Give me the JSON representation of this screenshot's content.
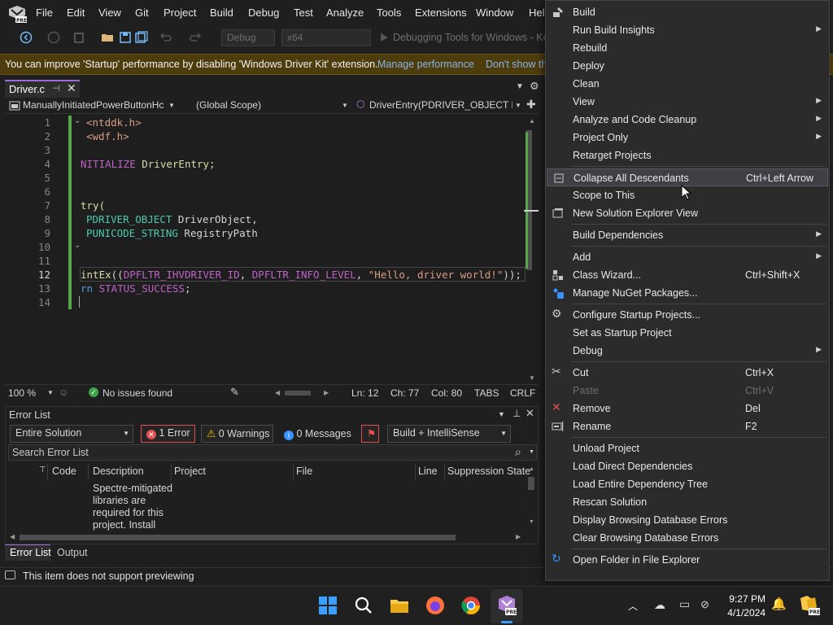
{
  "menubar": {
    "items": [
      "File",
      "Edit",
      "View",
      "Git",
      "Project",
      "Build",
      "Debug",
      "Test",
      "Analyze",
      "Tools",
      "Extensions",
      "Window",
      "Help"
    ]
  },
  "toolbar": {
    "config": "Debug",
    "platform": "x64",
    "debug_target": "Debugging Tools for Windows - Ker"
  },
  "infobar": {
    "message": "You can improve 'Startup' performance by disabling 'Windows Driver Kit' extension.",
    "link1": "Manage performance",
    "link2": "Don't show th"
  },
  "editor": {
    "tab_label": "Driver.c",
    "nav_project": "ManuallyInitiatedPowerButtonHc",
    "nav_scope": "(Global Scope)",
    "nav_function": "DriverEntry(PDRIVER_OBJECT Driv",
    "line_numbers": [
      "1",
      "2",
      "3",
      "4",
      "5",
      "6",
      "7",
      "8",
      "9",
      "10",
      "11",
      "12",
      "13",
      "14"
    ],
    "current_line": 12,
    "lines": {
      "l1": "<ntddk.h>",
      "l2": "<wdf.h>",
      "l4a": "NITIALIZE",
      "l4b": " DriverEntry;",
      "l7": "try(",
      "l8a": "PDRIVER_OBJECT",
      "l8b": " DriverObject,",
      "l9a": "PUNICODE_STRING",
      "l9b": " RegistryPath",
      "l12a": "intEx",
      "l12b": "((",
      "l12c": "DPFLTR_IHVDRIVER_ID",
      "l12d": ", ",
      "l12e": "DPFLTR_INFO_LEVEL",
      "l12f": ", ",
      "l12g": "\"Hello, driver world!\"",
      "l12h": "));",
      "l13a": "rn ",
      "l13b": "STATUS_SUCCESS",
      "l13c": ";"
    }
  },
  "editor_status": {
    "zoom": "100 %",
    "issues": "No issues found",
    "ln": "Ln: 12",
    "ch": "Ch: 77",
    "col": "Col: 80",
    "tabs": "TABS",
    "eol": "CRLF"
  },
  "error_list": {
    "title": "Error List",
    "scope": "Entire Solution",
    "errors": "1 Error",
    "warnings": "0 Warnings",
    "messages": "0 Messages",
    "build_filter": "Build + IntelliSense",
    "search_placeholder": "Search Error List",
    "columns": [
      "Code",
      "Description",
      "Project",
      "File",
      "Line",
      "Suppression State"
    ],
    "row_description": [
      "Spectre-mitigated",
      "libraries are",
      "required for this",
      "project. Install"
    ]
  },
  "bottom_tabs": [
    "Error List",
    "Output"
  ],
  "status": {
    "message": "This item does not support previewing"
  },
  "context_menu": {
    "items": [
      {
        "label": "Build",
        "shortcut": "",
        "submenu": false,
        "icon": "build-icon"
      },
      {
        "label": "Run Build Insights",
        "shortcut": "",
        "submenu": true,
        "icon": ""
      },
      {
        "label": "Rebuild",
        "shortcut": "",
        "submenu": false,
        "icon": ""
      },
      {
        "label": "Deploy",
        "shortcut": "",
        "submenu": false,
        "icon": ""
      },
      {
        "label": "Clean",
        "shortcut": "",
        "submenu": false,
        "icon": ""
      },
      {
        "label": "View",
        "shortcut": "",
        "submenu": true,
        "icon": ""
      },
      {
        "label": "Analyze and Code Cleanup",
        "shortcut": "",
        "submenu": true,
        "icon": ""
      },
      {
        "label": "Project Only",
        "shortcut": "",
        "submenu": true,
        "icon": ""
      },
      {
        "label": "Retarget Projects",
        "shortcut": "",
        "submenu": false,
        "icon": ""
      },
      {
        "label": "Collapse All Descendants",
        "shortcut": "Ctrl+Left Arrow",
        "submenu": false,
        "icon": "collapse-icon"
      },
      {
        "label": "Scope to This",
        "shortcut": "",
        "submenu": false,
        "icon": ""
      },
      {
        "label": "New Solution Explorer View",
        "shortcut": "",
        "submenu": false,
        "icon": "new-view-icon"
      },
      {
        "label": "Build Dependencies",
        "shortcut": "",
        "submenu": true,
        "icon": ""
      },
      {
        "label": "Add",
        "shortcut": "",
        "submenu": true,
        "icon": ""
      },
      {
        "label": "Class Wizard...",
        "shortcut": "Ctrl+Shift+X",
        "submenu": false,
        "icon": "class-wizard-icon"
      },
      {
        "label": "Manage NuGet Packages...",
        "shortcut": "",
        "submenu": false,
        "icon": "nuget-icon"
      },
      {
        "label": "Configure Startup Projects...",
        "shortcut": "",
        "submenu": false,
        "icon": "gear-icon"
      },
      {
        "label": "Set as Startup Project",
        "shortcut": "",
        "submenu": false,
        "icon": ""
      },
      {
        "label": "Debug",
        "shortcut": "",
        "submenu": true,
        "icon": ""
      },
      {
        "label": "Cut",
        "shortcut": "Ctrl+X",
        "submenu": false,
        "icon": "cut-icon"
      },
      {
        "label": "Paste",
        "shortcut": "Ctrl+V",
        "submenu": false,
        "icon": "",
        "disabled": true
      },
      {
        "label": "Remove",
        "shortcut": "Del",
        "submenu": false,
        "icon": "remove-icon"
      },
      {
        "label": "Rename",
        "shortcut": "F2",
        "submenu": false,
        "icon": "rename-icon"
      },
      {
        "label": "Unload Project",
        "shortcut": "",
        "submenu": false,
        "icon": ""
      },
      {
        "label": "Load Direct Dependencies",
        "shortcut": "",
        "submenu": false,
        "icon": ""
      },
      {
        "label": "Load Entire Dependency Tree",
        "shortcut": "",
        "submenu": false,
        "icon": ""
      },
      {
        "label": "Rescan Solution",
        "shortcut": "",
        "submenu": false,
        "icon": ""
      },
      {
        "label": "Display Browsing Database Errors",
        "shortcut": "",
        "submenu": false,
        "icon": ""
      },
      {
        "label": "Clear Browsing Database Errors",
        "shortcut": "",
        "submenu": false,
        "icon": ""
      },
      {
        "label": "Open Folder in File Explorer",
        "shortcut": "",
        "submenu": false,
        "icon": "open-folder-icon"
      }
    ]
  },
  "taskbar": {
    "time": "9:27 PM",
    "date": "4/1/2024"
  },
  "colors": {
    "accent": "#9b6bd8",
    "infobar_bg": "#4d3c0c",
    "link": "#8ab4e8",
    "error": "#e05252"
  }
}
